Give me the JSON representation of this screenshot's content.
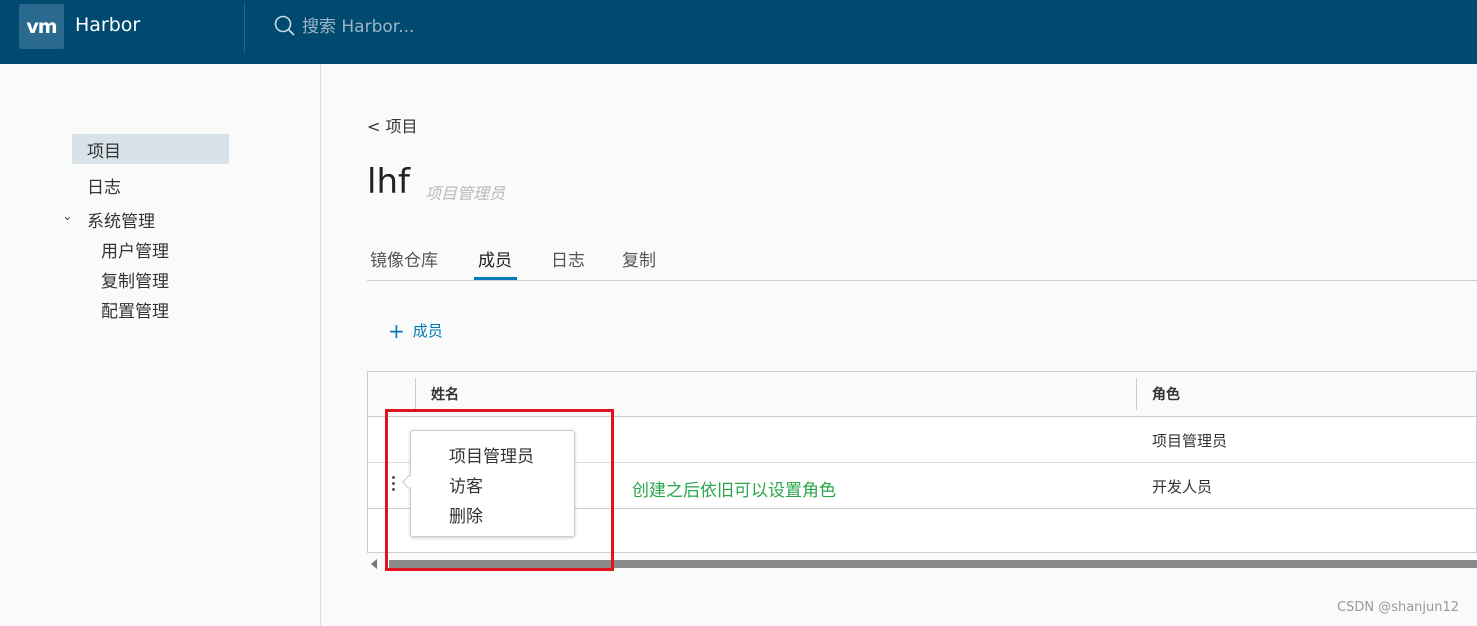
{
  "header": {
    "logo_text": "vm",
    "app_name": "Harbor",
    "search_placeholder": "搜索 Harbor..."
  },
  "sidebar": {
    "items": [
      {
        "label": "项目",
        "active": true
      },
      {
        "label": "日志"
      },
      {
        "label": "系统管理",
        "expanded": true
      },
      {
        "label": "用户管理"
      },
      {
        "label": "复制管理"
      },
      {
        "label": "配置管理"
      }
    ]
  },
  "main": {
    "breadcrumb": "< 项目",
    "title": "lhf",
    "role": "项目管理员",
    "tabs": [
      {
        "label": "镜像仓库"
      },
      {
        "label": "成员",
        "active": true
      },
      {
        "label": "日志"
      },
      {
        "label": "复制"
      }
    ],
    "add_member": "成员",
    "table": {
      "columns": [
        "姓名",
        "角色"
      ],
      "rows": [
        {
          "name": "",
          "role": "项目管理员"
        },
        {
          "name": "",
          "role": "开发人员"
        }
      ]
    },
    "role_menu": [
      "项目管理员",
      "访客",
      "删除"
    ]
  },
  "annotation": "创建之后依旧可以设置角色",
  "watermark": "CSDN @shanjun12",
  "colors": {
    "header_bg": "#004a70",
    "accent": "#0079b8",
    "highlight": "#e0141e",
    "annotation": "#2aa74a"
  }
}
